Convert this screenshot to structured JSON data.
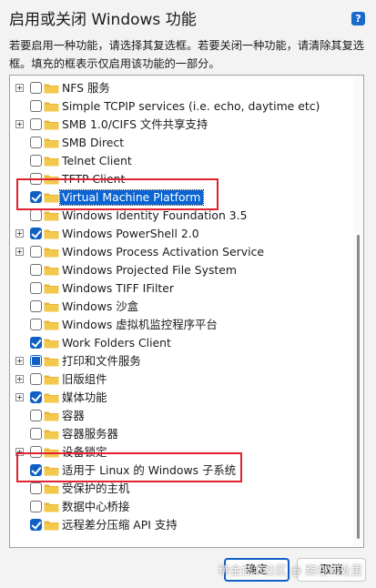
{
  "window": {
    "title": "启用或关闭 Windows 功能",
    "description": "若要启用一种功能，请选择其复选框。若要关闭一种功能，请清除其复选框。填充的框表示仅启用该功能的一部分。",
    "help_icon": "help-icon",
    "help_glyph": "?"
  },
  "features": [
    {
      "label": "NFS 服务",
      "expandable": true,
      "state": "unchecked"
    },
    {
      "label": "Simple TCPIP services (i.e. echo, daytime etc)",
      "expandable": false,
      "state": "unchecked"
    },
    {
      "label": "SMB 1.0/CIFS 文件共享支持",
      "expandable": true,
      "state": "unchecked"
    },
    {
      "label": "SMB Direct",
      "expandable": false,
      "state": "unchecked"
    },
    {
      "label": "Telnet Client",
      "expandable": false,
      "state": "unchecked"
    },
    {
      "label": "TFTP Client",
      "expandable": false,
      "state": "unchecked"
    },
    {
      "label": "Virtual Machine Platform",
      "expandable": false,
      "state": "checked",
      "selected": true
    },
    {
      "label": "Windows Identity Foundation 3.5",
      "expandable": false,
      "state": "unchecked"
    },
    {
      "label": "Windows PowerShell 2.0",
      "expandable": true,
      "state": "checked"
    },
    {
      "label": "Windows Process Activation Service",
      "expandable": true,
      "state": "unchecked"
    },
    {
      "label": "Windows Projected File System",
      "expandable": false,
      "state": "unchecked"
    },
    {
      "label": "Windows TIFF IFilter",
      "expandable": false,
      "state": "unchecked"
    },
    {
      "label": "Windows 沙盒",
      "expandable": false,
      "state": "unchecked"
    },
    {
      "label": "Windows 虚拟机监控程序平台",
      "expandable": false,
      "state": "unchecked"
    },
    {
      "label": "Work Folders Client",
      "expandable": false,
      "state": "checked"
    },
    {
      "label": "打印和文件服务",
      "expandable": true,
      "state": "partial"
    },
    {
      "label": "旧版组件",
      "expandable": true,
      "state": "unchecked"
    },
    {
      "label": "媒体功能",
      "expandable": true,
      "state": "checked"
    },
    {
      "label": "容器",
      "expandable": false,
      "state": "unchecked"
    },
    {
      "label": "容器服务器",
      "expandable": false,
      "state": "unchecked"
    },
    {
      "label": "设备锁定",
      "expandable": true,
      "state": "unchecked"
    },
    {
      "label": "适用于 Linux 的 Windows 子系统",
      "expandable": false,
      "state": "checked"
    },
    {
      "label": "受保护的主机",
      "expandable": false,
      "state": "unchecked"
    },
    {
      "label": "数据中心桥接",
      "expandable": false,
      "state": "unchecked"
    },
    {
      "label": "远程差分压缩 API 支持",
      "expandable": false,
      "state": "checked"
    }
  ],
  "buttons": {
    "ok_label": "确定",
    "cancel_label": "取消"
  },
  "watermark": "稀金技术社区 @ 踪在何处里",
  "colors": {
    "accent": "#1060c4",
    "folder": "#f2c94c",
    "annotation_red": "#e0212e"
  }
}
